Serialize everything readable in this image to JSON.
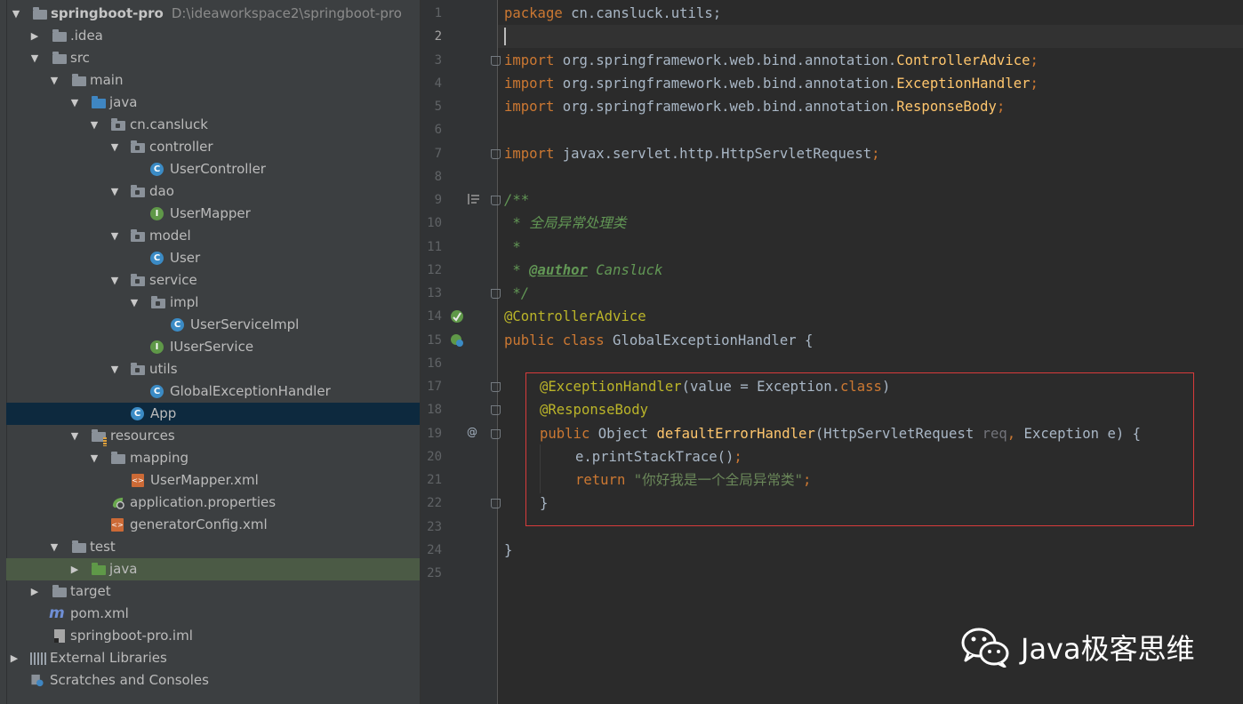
{
  "project": {
    "root_name": "springboot-pro",
    "root_path": "D:\\ideaworkspace2\\springboot-pro",
    "items": [
      {
        "label": "springboot-pro",
        "icon": "module-folder-icon"
      },
      {
        "label": ".idea",
        "icon": "folder-icon"
      },
      {
        "label": "src",
        "icon": "folder-icon"
      },
      {
        "label": "main",
        "icon": "folder-icon"
      },
      {
        "label": "java",
        "icon": "source-folder-icon"
      },
      {
        "label": "cn.cansluck",
        "icon": "package-icon"
      },
      {
        "label": "controller",
        "icon": "package-icon"
      },
      {
        "label": "UserController",
        "icon": "class-icon"
      },
      {
        "label": "dao",
        "icon": "package-icon"
      },
      {
        "label": "UserMapper",
        "icon": "interface-icon"
      },
      {
        "label": "model",
        "icon": "package-icon"
      },
      {
        "label": "User",
        "icon": "class-icon"
      },
      {
        "label": "service",
        "icon": "package-icon"
      },
      {
        "label": "impl",
        "icon": "package-icon"
      },
      {
        "label": "UserServiceImpl",
        "icon": "class-icon"
      },
      {
        "label": "IUserService",
        "icon": "interface-icon"
      },
      {
        "label": "utils",
        "icon": "package-icon"
      },
      {
        "label": "GlobalExceptionHandler",
        "icon": "class-icon"
      },
      {
        "label": "App",
        "icon": "spring-boot-class-icon"
      },
      {
        "label": "resources",
        "icon": "resources-folder-icon"
      },
      {
        "label": "mapping",
        "icon": "folder-icon"
      },
      {
        "label": "UserMapper.xml",
        "icon": "xml-file-icon"
      },
      {
        "label": "application.properties",
        "icon": "spring-properties-icon"
      },
      {
        "label": "generatorConfig.xml",
        "icon": "xml-file-icon"
      },
      {
        "label": "test",
        "icon": "folder-icon"
      },
      {
        "label": "java",
        "icon": "test-folder-icon"
      },
      {
        "label": "target",
        "icon": "folder-icon"
      },
      {
        "label": "pom.xml",
        "icon": "maven-icon"
      },
      {
        "label": "springboot-pro.iml",
        "icon": "iml-file-icon"
      },
      {
        "label": "External Libraries",
        "icon": "libraries-icon"
      },
      {
        "label": "Scratches and Consoles",
        "icon": "scratches-icon"
      }
    ],
    "icon_letters": {
      "class": "C",
      "interface": "I",
      "xml": "<>"
    }
  },
  "editor": {
    "line_numbers": [
      "1",
      "2",
      "3",
      "4",
      "5",
      "6",
      "7",
      "8",
      "9",
      "10",
      "11",
      "12",
      "13",
      "14",
      "15",
      "16",
      "17",
      "18",
      "19",
      "20",
      "21",
      "22",
      "23",
      "24",
      "25"
    ],
    "current_line": "2",
    "code": {
      "l1_kw": "package",
      "l1_rest": " cn.cansluck.utils;",
      "import_kw": "import",
      "l3_pkg": " org.springframework.web.bind.annotation.",
      "l3_cls": "ControllerAdvice",
      "l4_cls": "ExceptionHandler",
      "l5_cls": "ResponseBody",
      "semi": ";",
      "l7_pkg": " javax.servlet.http.HttpServletRequest",
      "l9": "/**",
      "l10": " * 全局异常处理类",
      "l11": " *",
      "l12_star": " * ",
      "l12_tag": "@author",
      "l12_name": " Cansluck",
      "l13": " */",
      "l14": "@ControllerAdvice",
      "l15_kw": "public class",
      "l15_rest": " GlobalExceptionHandler {",
      "l17_an": "@ExceptionHandler",
      "l17_open": "(value = Exception.",
      "l17_kw": "class",
      "l17_close": ")",
      "l18": "@ResponseBody",
      "l19_kw": "public",
      "l19_a": " Object ",
      "l19_fn": "defaultErrorHandler",
      "l19_b": "(HttpServletRequest ",
      "l19_req": "req",
      "l19_comma": ",",
      "l19_c": " Exception e) {",
      "l20": "e.printStackTrace()",
      "l21_kw": "return",
      "l21_str": "\"你好我是一个全局异常类\"",
      "l22": "}",
      "l24": "}"
    },
    "gutter_at_symbol": "@"
  },
  "watermark": {
    "text": "Java极客思维"
  },
  "colors": {
    "editor_bg": "#2b2b2b",
    "tree_bg": "#3c3f41",
    "keyword": "#cc7832",
    "annotation": "#bbb529",
    "comment": "#629755",
    "string": "#6a8759",
    "method": "#ffc66d",
    "highlight_box": "#d83b3b"
  }
}
